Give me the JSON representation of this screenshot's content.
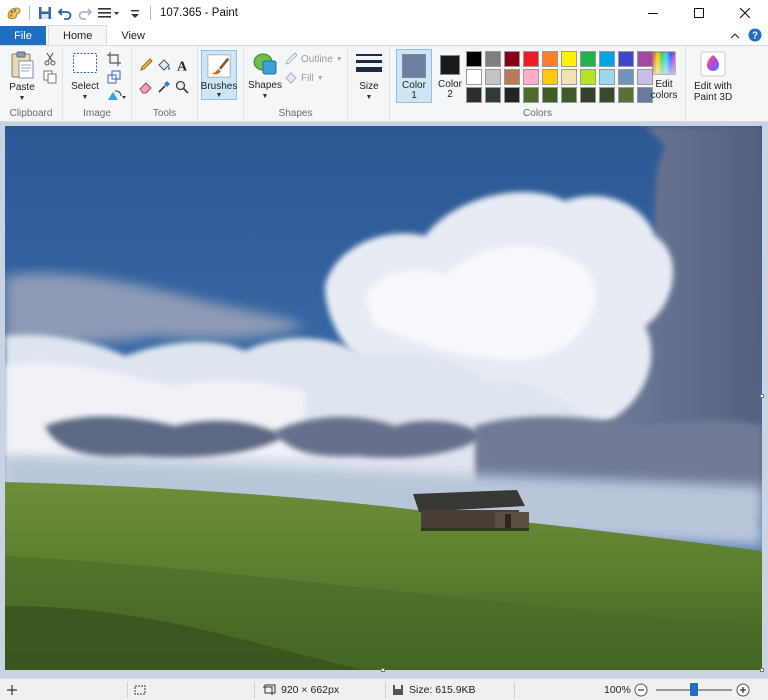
{
  "window": {
    "title": "107.365 - Paint",
    "controls": [
      "minimize-icon",
      "maximize-icon",
      "close-icon"
    ]
  },
  "quick_access": [
    "paint-app-icon",
    "save-icon",
    "undo-icon",
    "redo-icon",
    "customize-menu-icon"
  ],
  "tabs": [
    {
      "label": "File"
    },
    {
      "label": "Home"
    },
    {
      "label": "View"
    }
  ],
  "ribbon": {
    "clipboard": {
      "group_label": "Clipboard",
      "paste_label": "Paste"
    },
    "image": {
      "group_label": "Image",
      "select_label": "Select"
    },
    "tools": {
      "group_label": "Tools"
    },
    "brushes": {
      "label": "Brushes"
    },
    "shapes": {
      "group_label": "Shapes",
      "shapes_label": "Shapes",
      "outline_label": "Outline",
      "fill_label": "Fill"
    },
    "size": {
      "label": "Size"
    },
    "colors": {
      "group_label": "Colors",
      "color1_label": "Color 1",
      "color2_label": "Color 2",
      "edit_colors_label": "Edit colors",
      "color1_value": "#6b7fa0",
      "color2_value": "#1a1a1a",
      "palette": [
        "#000000",
        "#7f7f7f",
        "#880015",
        "#ed1c24",
        "#ff7f27",
        "#fff200",
        "#22b14c",
        "#00a2e8",
        "#3f48cc",
        "#a349a4",
        "#ffffff",
        "#c3c3c3",
        "#b97a57",
        "#ffaec9",
        "#ffc90e",
        "#efe4b0",
        "#b5e61d",
        "#99d9ea",
        "#7092be",
        "#c8bfe7",
        "#2b2e31",
        "#2f3b37",
        "#1f2326",
        "#4e6a2e",
        "#3e5f24",
        "#405a2e",
        "#31412a",
        "#384b2e",
        "#5a7038",
        "#6a7a9c"
      ]
    },
    "paint3d": {
      "label": "Edit with Paint 3D"
    }
  },
  "status": {
    "dimensions": "920 × 662px",
    "size": "Size: 615.9KB",
    "zoom": "100%",
    "zoom_fraction": 0.5
  }
}
